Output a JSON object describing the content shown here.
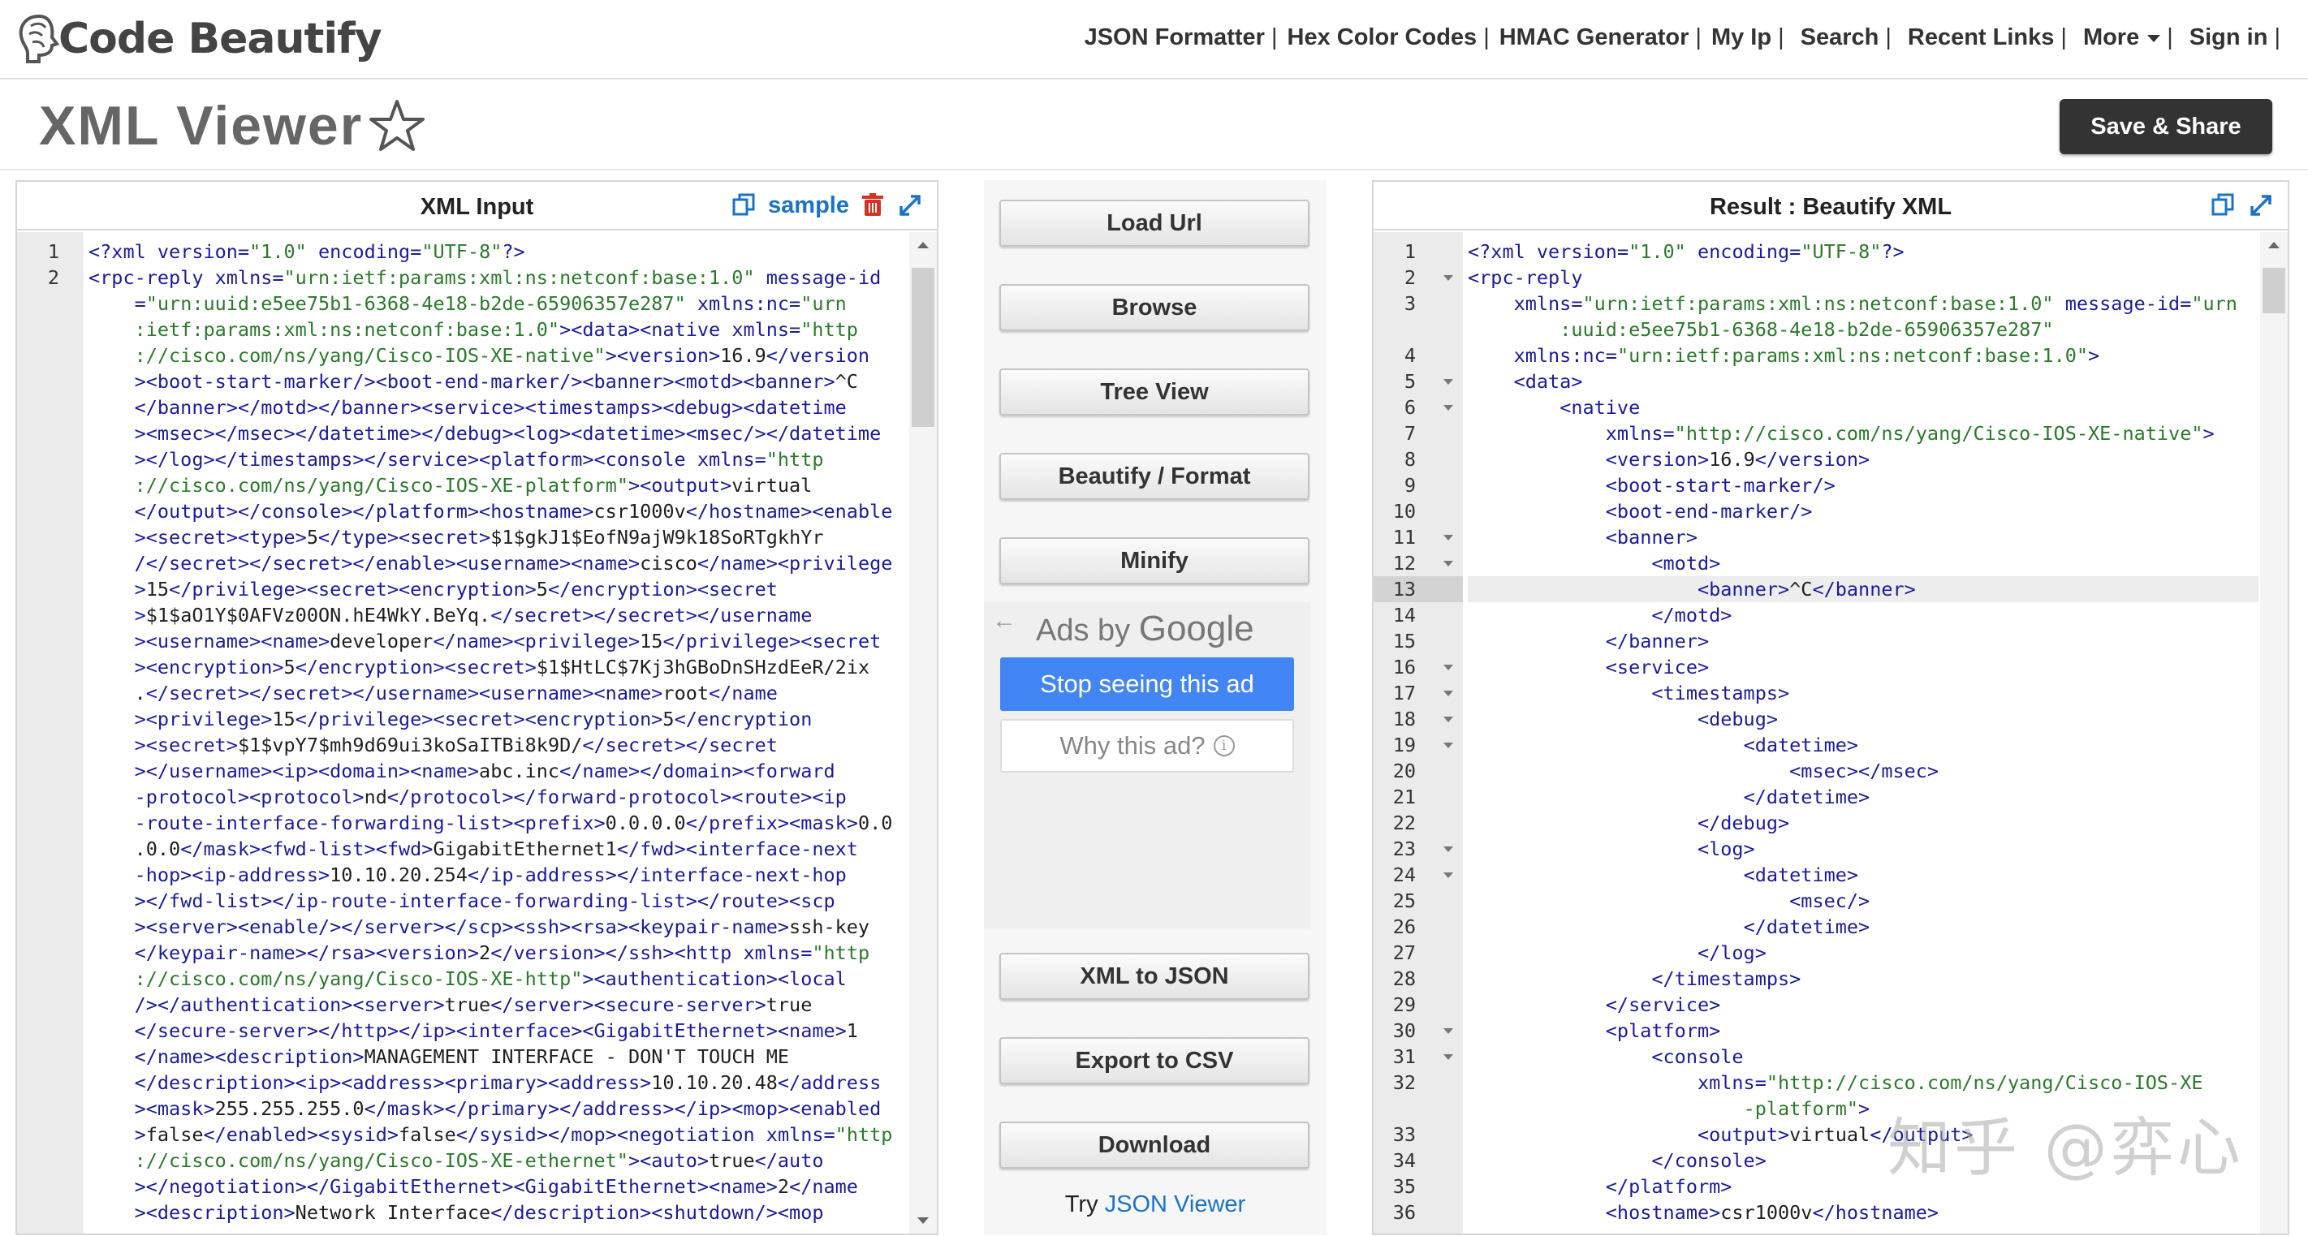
{
  "brand": {
    "name": "Code Beautify"
  },
  "nav": {
    "items": [
      "JSON Formatter",
      "Hex Color Codes",
      "HMAC Generator",
      "My Ip",
      "Search",
      "Recent Links",
      "More",
      "Sign in"
    ]
  },
  "page": {
    "title": "XML Viewer",
    "save_label": "Save & Share"
  },
  "input_panel": {
    "title": "XML Input",
    "sample_label": "sample"
  },
  "result_panel": {
    "title": "Result : Beautify XML"
  },
  "actions": {
    "load_url": "Load Url",
    "browse": "Browse",
    "tree_view": "Tree View",
    "beautify": "Beautify / Format",
    "minify": "Minify",
    "xml_to_json": "XML to JSON",
    "export_csv": "Export to CSV",
    "download": "Download"
  },
  "ads": {
    "back": "←",
    "ads_by": "Ads by",
    "google": "Google",
    "stop": "Stop seeing this ad",
    "why": "Why this ad?",
    "info": "i"
  },
  "try": {
    "prefix": "Try",
    "link": "JSON Viewer"
  },
  "watermark": "知乎 @弈心",
  "left_editor": {
    "lines": [
      {
        "n": "1",
        "html": "<span class='t'>&lt;?xml</span> <span class='a'>version=</span><span class='s'>\"1.0\"</span> <span class='a'>encoding=</span><span class='s'>\"UTF-8\"</span><span class='t'>?&gt;</span>"
      },
      {
        "n": "2",
        "html": "<span class='t'>&lt;rpc-reply</span> <span class='a'>xmlns=</span><span class='s'>\"urn:ietf:params:xml:ns:netconf:base:1.0\"</span> <span class='a'>message-id</span>"
      },
      {
        "n": "",
        "html": "    <span class='a'>=</span><span class='s'>\"urn:uuid:e5ee75b1-6368-4e18-b2de-65906357e287\"</span> <span class='a'>xmlns:nc=</span><span class='s'>\"urn</span>"
      },
      {
        "n": "",
        "html": "    <span class='s'>:ietf:params:xml:ns:netconf:base:1.0\"</span><span class='t'>&gt;&lt;data&gt;&lt;native</span> <span class='a'>xmlns=</span><span class='s'>\"http</span>"
      },
      {
        "n": "",
        "html": "    <span class='s'>://cisco.com/ns/yang/Cisco-IOS-XE-native\"</span><span class='t'>&gt;&lt;version&gt;</span>16.9<span class='t'>&lt;/version</span>"
      },
      {
        "n": "",
        "html": "    <span class='t'>&gt;&lt;boot-start-marker/&gt;&lt;boot-end-marker/&gt;&lt;banner&gt;&lt;motd&gt;&lt;banner&gt;</span>^C"
      },
      {
        "n": "",
        "html": "    <span class='t'>&lt;/banner&gt;&lt;/motd&gt;&lt;/banner&gt;&lt;service&gt;&lt;timestamps&gt;&lt;debug&gt;&lt;datetime</span>"
      },
      {
        "n": "",
        "html": "    <span class='t'>&gt;&lt;msec&gt;&lt;/msec&gt;&lt;/datetime&gt;&lt;/debug&gt;&lt;log&gt;&lt;datetime&gt;&lt;msec/&gt;&lt;/datetime</span>"
      },
      {
        "n": "",
        "html": "    <span class='t'>&gt;&lt;/log&gt;&lt;/timestamps&gt;&lt;/service&gt;&lt;platform&gt;&lt;console</span> <span class='a'>xmlns=</span><span class='s'>\"http</span>"
      },
      {
        "n": "",
        "html": "    <span class='s'>://cisco.com/ns/yang/Cisco-IOS-XE-platform\"</span><span class='t'>&gt;&lt;output&gt;</span>virtual"
      },
      {
        "n": "",
        "html": "    <span class='t'>&lt;/output&gt;&lt;/console&gt;&lt;/platform&gt;&lt;hostname&gt;</span>csr1000v<span class='t'>&lt;/hostname&gt;&lt;enable</span>"
      },
      {
        "n": "",
        "html": "    <span class='t'>&gt;&lt;secret&gt;&lt;type&gt;</span>5<span class='t'>&lt;/type&gt;&lt;secret&gt;</span>$1$gkJ1$EofN9ajW9k18SoRTgkhYr"
      },
      {
        "n": "",
        "html": "    <span class='t'>/&lt;/secret&gt;&lt;/secret&gt;&lt;/enable&gt;&lt;username&gt;&lt;name&gt;</span>cisco<span class='t'>&lt;/name&gt;&lt;privilege</span>"
      },
      {
        "n": "",
        "html": "    <span class='t'>&gt;</span>15<span class='t'>&lt;/privilege&gt;&lt;secret&gt;&lt;encryption&gt;</span>5<span class='t'>&lt;/encryption&gt;&lt;secret</span>"
      },
      {
        "n": "",
        "html": "    <span class='t'>&gt;</span>$1$aO1Y$0AFVz00ON.hE4WkY.BeYq.<span class='t'>&lt;/secret&gt;&lt;/secret&gt;&lt;/username</span>"
      },
      {
        "n": "",
        "html": "    <span class='t'>&gt;&lt;username&gt;&lt;name&gt;</span>developer<span class='t'>&lt;/name&gt;&lt;privilege&gt;</span>15<span class='t'>&lt;/privilege&gt;&lt;secret</span>"
      },
      {
        "n": "",
        "html": "    <span class='t'>&gt;&lt;encryption&gt;</span>5<span class='t'>&lt;/encryption&gt;&lt;secret&gt;</span>$1$HtLC$7Kj3hGBoDnSHzdEeR/2ix"
      },
      {
        "n": "",
        "html": "    .<span class='t'>&lt;/secret&gt;&lt;/secret&gt;&lt;/username&gt;&lt;username&gt;&lt;name&gt;</span>root<span class='t'>&lt;/name</span>"
      },
      {
        "n": "",
        "html": "    <span class='t'>&gt;&lt;privilege&gt;</span>15<span class='t'>&lt;/privilege&gt;&lt;secret&gt;&lt;encryption&gt;</span>5<span class='t'>&lt;/encryption</span>"
      },
      {
        "n": "",
        "html": "    <span class='t'>&gt;&lt;secret&gt;</span>$1$vpY7$mh9d69ui3koSaITBi8k9D/<span class='t'>&lt;/secret&gt;&lt;/secret</span>"
      },
      {
        "n": "",
        "html": "    <span class='t'>&gt;&lt;/username&gt;&lt;ip&gt;&lt;domain&gt;&lt;name&gt;</span>abc.inc<span class='t'>&lt;/name&gt;&lt;/domain&gt;&lt;forward</span>"
      },
      {
        "n": "",
        "html": "    <span class='t'>-protocol&gt;&lt;protocol&gt;</span>nd<span class='t'>&lt;/protocol&gt;&lt;/forward-protocol&gt;&lt;route&gt;&lt;ip</span>"
      },
      {
        "n": "",
        "html": "    <span class='t'>-route-interface-forwarding-list&gt;&lt;prefix&gt;</span>0.0.0.0<span class='t'>&lt;/prefix&gt;&lt;mask&gt;</span>0.0"
      },
      {
        "n": "",
        "html": "    .0.0<span class='t'>&lt;/mask&gt;&lt;fwd-list&gt;&lt;fwd&gt;</span>GigabitEthernet1<span class='t'>&lt;/fwd&gt;&lt;interface-next</span>"
      },
      {
        "n": "",
        "html": "    <span class='t'>-hop&gt;&lt;ip-address&gt;</span>10.10.20.254<span class='t'>&lt;/ip-address&gt;&lt;/interface-next-hop</span>"
      },
      {
        "n": "",
        "html": "    <span class='t'>&gt;&lt;/fwd-list&gt;&lt;/ip-route-interface-forwarding-list&gt;&lt;/route&gt;&lt;scp</span>"
      },
      {
        "n": "",
        "html": "    <span class='t'>&gt;&lt;server&gt;&lt;enable/&gt;&lt;/server&gt;&lt;/scp&gt;&lt;ssh&gt;&lt;rsa&gt;&lt;keypair-name&gt;</span>ssh-key"
      },
      {
        "n": "",
        "html": "    <span class='t'>&lt;/keypair-name&gt;&lt;/rsa&gt;&lt;version&gt;</span>2<span class='t'>&lt;/version&gt;&lt;/ssh&gt;&lt;http</span> <span class='a'>xmlns=</span><span class='s'>\"http</span>"
      },
      {
        "n": "",
        "html": "    <span class='s'>://cisco.com/ns/yang/Cisco-IOS-XE-http\"</span><span class='t'>&gt;&lt;authentication&gt;&lt;local</span>"
      },
      {
        "n": "",
        "html": "    <span class='t'>/&gt;&lt;/authentication&gt;&lt;server&gt;</span>true<span class='t'>&lt;/server&gt;&lt;secure-server&gt;</span>true"
      },
      {
        "n": "",
        "html": "    <span class='t'>&lt;/secure-server&gt;&lt;/http&gt;&lt;/ip&gt;&lt;interface&gt;&lt;GigabitEthernet&gt;&lt;name&gt;</span>1"
      },
      {
        "n": "",
        "html": "    <span class='t'>&lt;/name&gt;&lt;description&gt;</span>MANAGEMENT INTERFACE - DON'T TOUCH ME"
      },
      {
        "n": "",
        "html": "    <span class='t'>&lt;/description&gt;&lt;ip&gt;&lt;address&gt;&lt;primary&gt;&lt;address&gt;</span>10.10.20.48<span class='t'>&lt;/address</span>"
      },
      {
        "n": "",
        "html": "    <span class='t'>&gt;&lt;mask&gt;</span>255.255.255.0<span class='t'>&lt;/mask&gt;&lt;/primary&gt;&lt;/address&gt;&lt;/ip&gt;&lt;mop&gt;&lt;enabled</span>"
      },
      {
        "n": "",
        "html": "    <span class='t'>&gt;</span>false<span class='t'>&lt;/enabled&gt;&lt;sysid&gt;</span>false<span class='t'>&lt;/sysid&gt;&lt;/mop&gt;&lt;negotiation</span> <span class='a'>xmlns=</span><span class='s'>\"http</span>"
      },
      {
        "n": "",
        "html": "    <span class='s'>://cisco.com/ns/yang/Cisco-IOS-XE-ethernet\"</span><span class='t'>&gt;&lt;auto&gt;</span>true<span class='t'>&lt;/auto</span>"
      },
      {
        "n": "",
        "html": "    <span class='t'>&gt;&lt;/negotiation&gt;&lt;/GigabitEthernet&gt;&lt;GigabitEthernet&gt;&lt;name&gt;</span>2<span class='t'>&lt;/name</span>"
      },
      {
        "n": "",
        "html": "    <span class='t'>&gt;&lt;description&gt;</span>Network Interface<span class='t'>&lt;/description&gt;&lt;shutdown/&gt;&lt;mop</span>"
      }
    ]
  },
  "right_editor": {
    "lines": [
      {
        "n": "1",
        "f": false,
        "html": "<span class='t'>&lt;?xml</span> <span class='a'>version=</span><span class='s'>\"1.0\"</span> <span class='a'>encoding=</span><span class='s'>\"UTF-8\"</span><span class='t'>?&gt;</span>"
      },
      {
        "n": "2",
        "f": true,
        "html": "<span class='t'>&lt;rpc-reply</span>"
      },
      {
        "n": "3",
        "f": false,
        "html": "    <span class='a'>xmlns=</span><span class='s'>\"urn:ietf:params:xml:ns:netconf:base:1.0\"</span> <span class='a'>message-id=</span><span class='s'>\"urn</span>"
      },
      {
        "n": "",
        "f": false,
        "html": "        <span class='s'>:uuid:e5ee75b1-6368-4e18-b2de-65906357e287\"</span>"
      },
      {
        "n": "4",
        "f": false,
        "html": "    <span class='a'>xmlns:nc=</span><span class='s'>\"urn:ietf:params:xml:ns:netconf:base:1.0\"</span><span class='t'>&gt;</span>"
      },
      {
        "n": "5",
        "f": true,
        "html": "    <span class='t'>&lt;data&gt;</span>"
      },
      {
        "n": "6",
        "f": true,
        "html": "        <span class='t'>&lt;native</span>"
      },
      {
        "n": "7",
        "f": false,
        "html": "            <span class='a'>xmlns=</span><span class='s'>\"http://cisco.com/ns/yang/Cisco-IOS-XE-native\"</span><span class='t'>&gt;</span>"
      },
      {
        "n": "8",
        "f": false,
        "html": "            <span class='t'>&lt;version&gt;</span>16.9<span class='t'>&lt;/version&gt;</span>"
      },
      {
        "n": "9",
        "f": false,
        "html": "            <span class='t'>&lt;boot-start-marker/&gt;</span>"
      },
      {
        "n": "10",
        "f": false,
        "html": "            <span class='t'>&lt;boot-end-marker/&gt;</span>"
      },
      {
        "n": "11",
        "f": true,
        "html": "            <span class='t'>&lt;banner&gt;</span>"
      },
      {
        "n": "12",
        "f": true,
        "html": "                <span class='t'>&lt;motd&gt;</span>"
      },
      {
        "n": "13",
        "f": false,
        "html": "                    <span class='t'>&lt;banner&gt;</span>^C<span class='t'>&lt;/banner&gt;</span>"
      },
      {
        "n": "14",
        "f": false,
        "html": "                <span class='t'>&lt;/motd&gt;</span>"
      },
      {
        "n": "15",
        "f": false,
        "html": "            <span class='t'>&lt;/banner&gt;</span>"
      },
      {
        "n": "16",
        "f": true,
        "html": "            <span class='t'>&lt;service&gt;</span>"
      },
      {
        "n": "17",
        "f": true,
        "html": "                <span class='t'>&lt;timestamps&gt;</span>"
      },
      {
        "n": "18",
        "f": true,
        "html": "                    <span class='t'>&lt;debug&gt;</span>"
      },
      {
        "n": "19",
        "f": true,
        "html": "                        <span class='t'>&lt;datetime&gt;</span>"
      },
      {
        "n": "20",
        "f": false,
        "html": "                            <span class='t'>&lt;msec&gt;&lt;/msec&gt;</span>"
      },
      {
        "n": "21",
        "f": false,
        "html": "                        <span class='t'>&lt;/datetime&gt;</span>"
      },
      {
        "n": "22",
        "f": false,
        "html": "                    <span class='t'>&lt;/debug&gt;</span>"
      },
      {
        "n": "23",
        "f": true,
        "html": "                    <span class='t'>&lt;log&gt;</span>"
      },
      {
        "n": "24",
        "f": true,
        "html": "                        <span class='t'>&lt;datetime&gt;</span>"
      },
      {
        "n": "25",
        "f": false,
        "html": "                            <span class='t'>&lt;msec/&gt;</span>"
      },
      {
        "n": "26",
        "f": false,
        "html": "                        <span class='t'>&lt;/datetime&gt;</span>"
      },
      {
        "n": "27",
        "f": false,
        "html": "                    <span class='t'>&lt;/log&gt;</span>"
      },
      {
        "n": "28",
        "f": false,
        "html": "                <span class='t'>&lt;/timestamps&gt;</span>"
      },
      {
        "n": "29",
        "f": false,
        "html": "            <span class='t'>&lt;/service&gt;</span>"
      },
      {
        "n": "30",
        "f": true,
        "html": "            <span class='t'>&lt;platform&gt;</span>"
      },
      {
        "n": "31",
        "f": true,
        "html": "                <span class='t'>&lt;console</span>"
      },
      {
        "n": "32",
        "f": false,
        "html": "                    <span class='a'>xmlns=</span><span class='s'>\"http://cisco.com/ns/yang/Cisco-IOS-XE</span>"
      },
      {
        "n": "",
        "f": false,
        "html": "                        <span class='s'>-platform\"</span><span class='t'>&gt;</span>"
      },
      {
        "n": "33",
        "f": false,
        "html": "                    <span class='t'>&lt;output&gt;</span>virtual<span class='t'>&lt;/output&gt;</span>"
      },
      {
        "n": "34",
        "f": false,
        "html": "                <span class='t'>&lt;/console&gt;</span>"
      },
      {
        "n": "35",
        "f": false,
        "html": "            <span class='t'>&lt;/platform&gt;</span>"
      },
      {
        "n": "36",
        "f": false,
        "html": "            <span class='t'>&lt;hostname&gt;</span>csr1000v<span class='t'>&lt;/hostname&gt;</span>"
      }
    ]
  }
}
